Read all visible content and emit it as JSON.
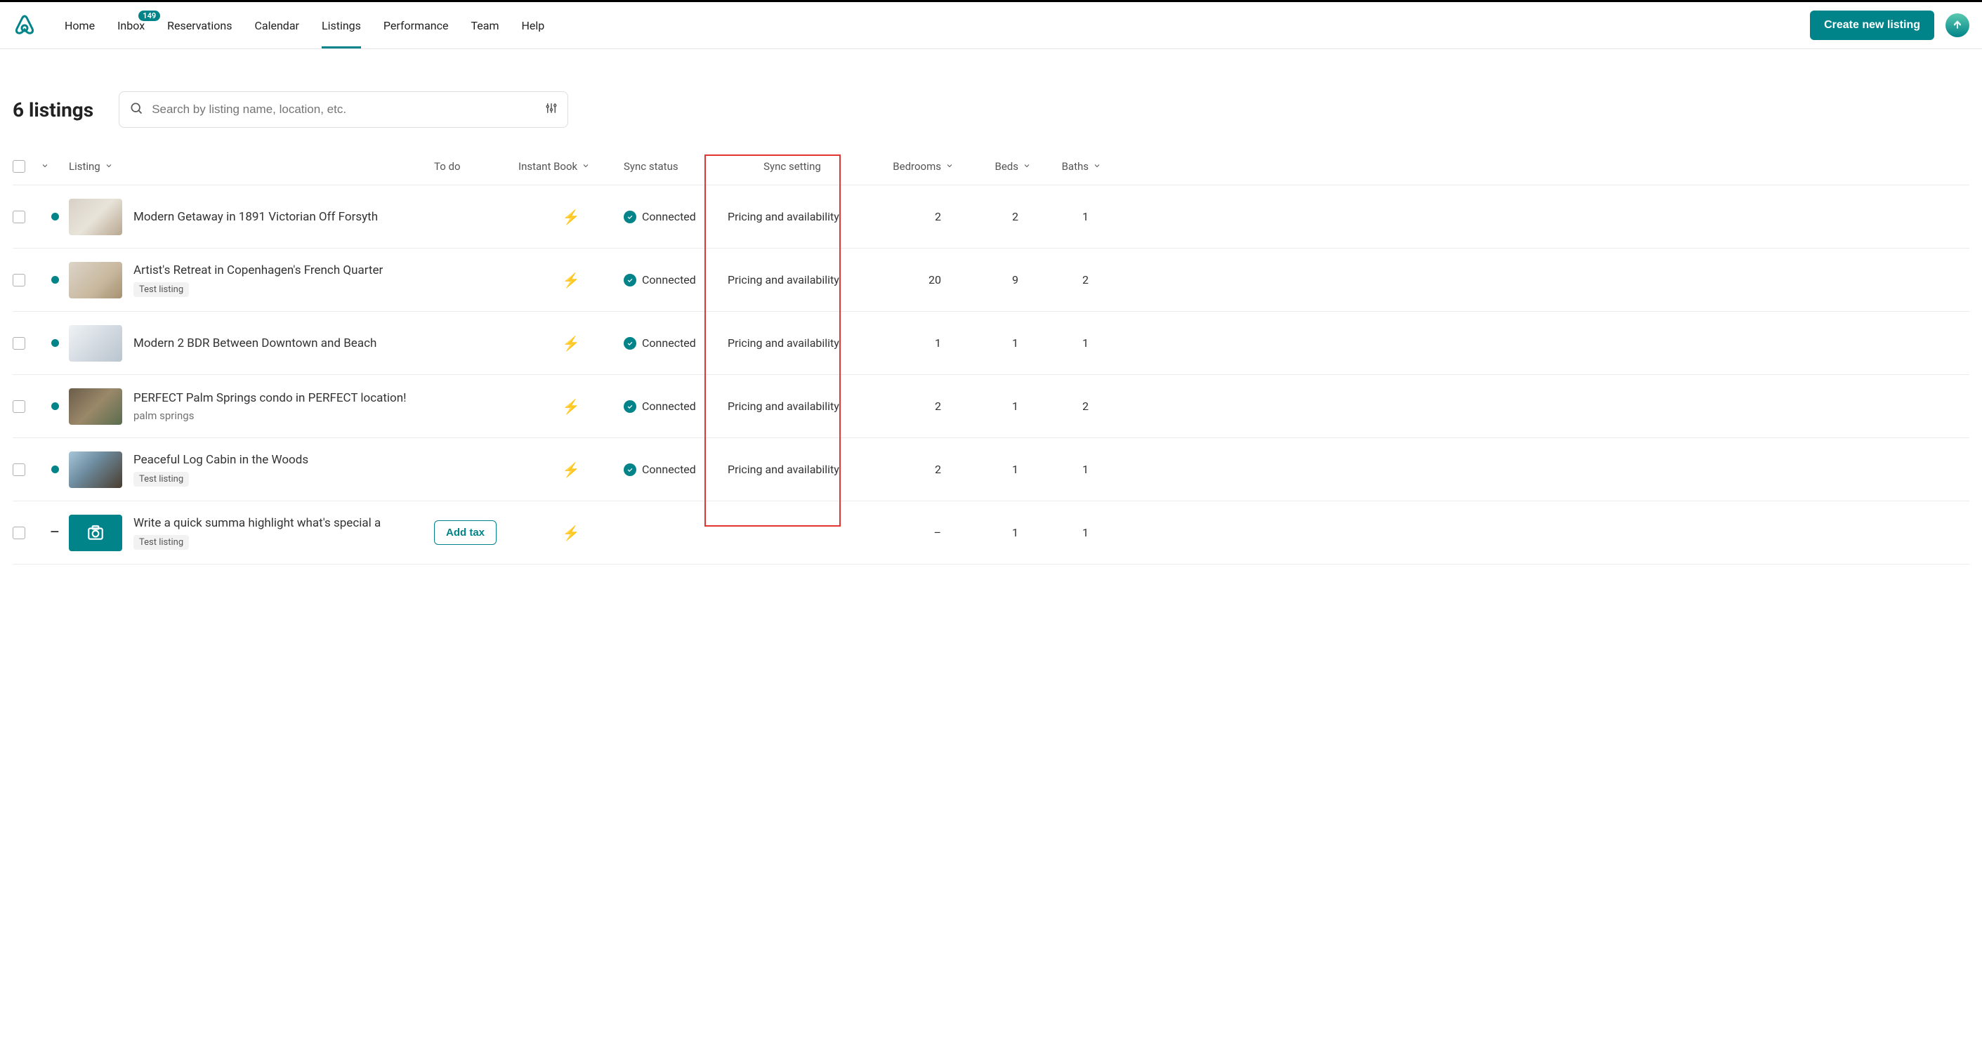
{
  "nav": {
    "items": [
      "Home",
      "Inbox",
      "Reservations",
      "Calendar",
      "Listings",
      "Performance",
      "Team",
      "Help"
    ],
    "active_index": 4,
    "inbox_badge": "149"
  },
  "cta_label": "Create new listing",
  "page_title": "6 listings",
  "search": {
    "placeholder": "Search by listing name, location, etc."
  },
  "columns": {
    "listing": "Listing",
    "todo": "To do",
    "instant": "Instant Book",
    "sync_status": "Sync status",
    "sync_setting": "Sync setting",
    "bedrooms": "Bedrooms",
    "beds": "Beds",
    "baths": "Baths"
  },
  "rows": [
    {
      "status": "active",
      "title": "Modern Getaway in 1891 Victorian Off Forsyth",
      "subtitle": "",
      "tag": "",
      "todo": "",
      "instant": true,
      "sync_status": "Connected",
      "sync_setting": "Pricing and availability",
      "bedrooms": "2",
      "beds": "2",
      "baths": "1",
      "thumb_class": "t1"
    },
    {
      "status": "active",
      "title": "Artist's Retreat in Copenhagen's French Quarter",
      "subtitle": "",
      "tag": "Test listing",
      "todo": "",
      "instant": true,
      "sync_status": "Connected",
      "sync_setting": "Pricing and availability",
      "bedrooms": "20",
      "beds": "9",
      "baths": "2",
      "thumb_class": "t2"
    },
    {
      "status": "active",
      "title": "Modern 2 BDR Between Downtown and Beach",
      "subtitle": "",
      "tag": "",
      "todo": "",
      "instant": true,
      "sync_status": "Connected",
      "sync_setting": "Pricing and availability",
      "bedrooms": "1",
      "beds": "1",
      "baths": "1",
      "thumb_class": "t3"
    },
    {
      "status": "active",
      "title": "PERFECT Palm Springs condo in PERFECT location!",
      "subtitle": "palm springs",
      "tag": "",
      "todo": "",
      "instant": true,
      "sync_status": "Connected",
      "sync_setting": "Pricing and availability",
      "bedrooms": "2",
      "beds": "1",
      "baths": "2",
      "thumb_class": "t4"
    },
    {
      "status": "active",
      "title": "Peaceful Log Cabin in the Woods",
      "subtitle": "",
      "tag": "Test listing",
      "todo": "",
      "instant": true,
      "sync_status": "Connected",
      "sync_setting": "Pricing and availability",
      "bedrooms": "2",
      "beds": "1",
      "baths": "1",
      "thumb_class": "t5"
    },
    {
      "status": "none",
      "title": "Write a quick summa highlight what's special a",
      "subtitle": "",
      "tag": "Test listing",
      "todo": "Add tax",
      "instant": true,
      "sync_status": "",
      "sync_setting": "",
      "bedrooms": "–",
      "beds": "1",
      "baths": "1",
      "thumb_class": "ph"
    }
  ],
  "highlight": {
    "visible": true
  }
}
